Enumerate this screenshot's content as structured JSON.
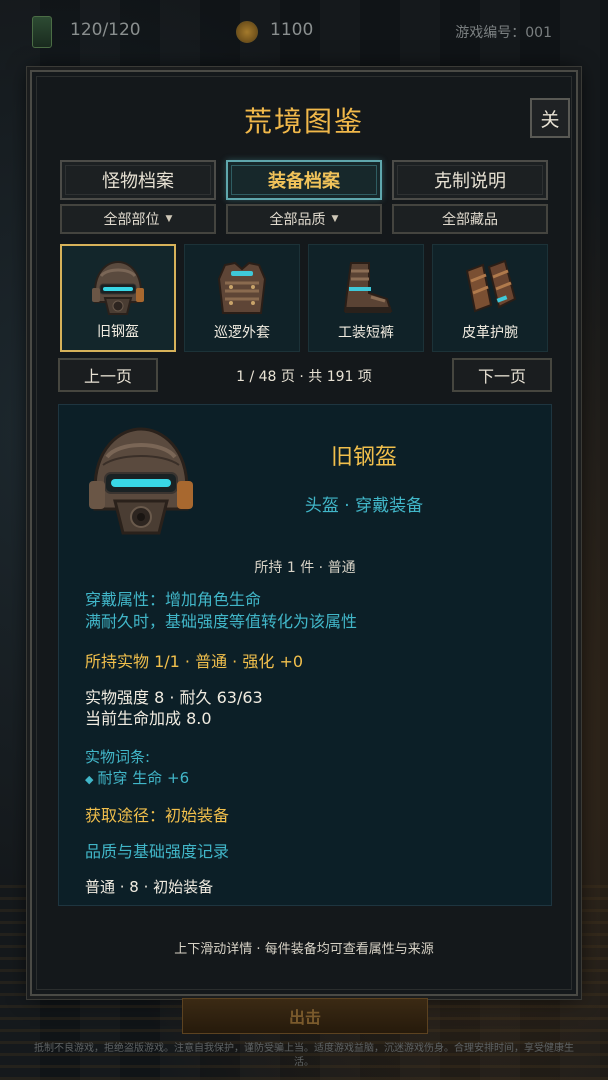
{
  "topbar": {
    "hp": "120/120",
    "coins": "1100",
    "game_id": "游戏编号：001"
  },
  "panel": {
    "title": "荒境图鉴",
    "close": "关",
    "tabs": [
      "怪物档案",
      "装备档案",
      "克制说明"
    ],
    "active_tab": 1,
    "filters": [
      "全部部位",
      "全部品质",
      "全部藏品"
    ],
    "items": [
      {
        "label": "旧钢盔",
        "icon": "helmet-icon",
        "selected": true
      },
      {
        "label": "巡逻外套",
        "icon": "vest-icon",
        "selected": false
      },
      {
        "label": "工装短裤",
        "icon": "boots-icon",
        "selected": false
      },
      {
        "label": "皮革护腕",
        "icon": "bracer-icon",
        "selected": false
      }
    ],
    "prev_page": "上一页",
    "next_page": "下一页",
    "page_info": "1 / 48 页 · 共 191 项"
  },
  "detail": {
    "name": "旧钢盔",
    "type": "头盔 · 穿戴装备",
    "owned": "所持 1 件 · 普通",
    "attr_line1": "穿戴属性：增加角色生命",
    "attr_line2": "满耐久时，基础强度等值转化为该属性",
    "held": "所持实物 1/1 · 普通 · 强化 +0",
    "stat_line1": "实物强度 8 · 耐久 63/63",
    "stat_line2": "当前生命加成 8.0",
    "affix_title": "实物词条:",
    "affix_diamond": "◆",
    "affix_value": "耐穿 生命 +6",
    "source": "获取途径：初始装备",
    "record_title": "品质与基础强度记录",
    "record_value": "普通 · 8 · 初始装备"
  },
  "footer_hint": "上下滑动详情 · 每件装备均可查看属性与来源",
  "sortie": "出击",
  "notice": "抵制不良游戏，拒绝盗版游戏。注意自我保护，谨防受骗上当。适度游戏益脑，沉迷游戏伤身。合理安排时间，享受健康生活。",
  "colors": {
    "accent_gold": "#f1bf4c",
    "accent_cyan": "#41b6c8",
    "active_tab_border": "#5fa7ad"
  }
}
